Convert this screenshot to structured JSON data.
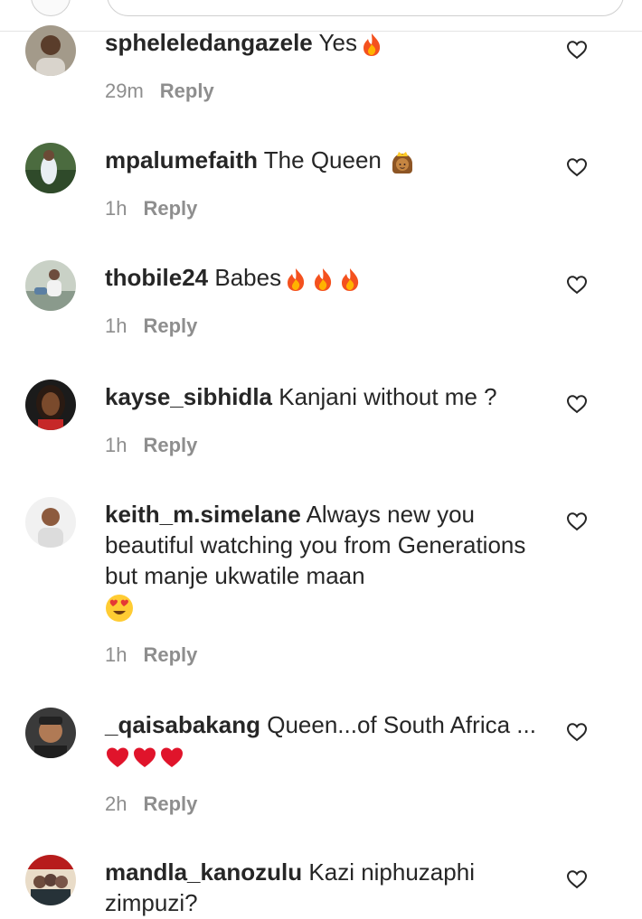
{
  "composer": {
    "placeholder": ""
  },
  "actions": {
    "reply_label": "Reply"
  },
  "comments": [
    {
      "username": "spheleledangazele",
      "text": "Yes",
      "emojis": [
        "fire"
      ],
      "time": "29m"
    },
    {
      "username": "mpalumefaith",
      "text": "The Queen",
      "emojis": [
        "princess"
      ],
      "time": "1h"
    },
    {
      "username": "thobile24",
      "text": "Babes",
      "emojis": [
        "fire",
        "fire",
        "fire"
      ],
      "time": "1h"
    },
    {
      "username": "kayse_sibhidla",
      "text": "Kanjani without me ?",
      "emojis": [],
      "time": "1h"
    },
    {
      "username": "keith_m.simelane",
      "text": "Always new you beautiful watching you from Generations but manje ukwatile maan",
      "emojis": [
        "heart-eyes"
      ],
      "time": "1h"
    },
    {
      "username": "_qaisabakang",
      "text": "Queen...of South Africa ...",
      "emojis": [
        "red-heart",
        "red-heart",
        "red-heart"
      ],
      "time": "2h"
    },
    {
      "username": "mandla_kanozulu",
      "text": "Kazi niphuzaphi zimpuzi?",
      "emojis": [],
      "time": ""
    }
  ],
  "icons": {
    "like": "heart-outline-icon"
  },
  "colors": {
    "text": "#262626",
    "meta": "#8e8e8e",
    "background": "#ffffff"
  }
}
